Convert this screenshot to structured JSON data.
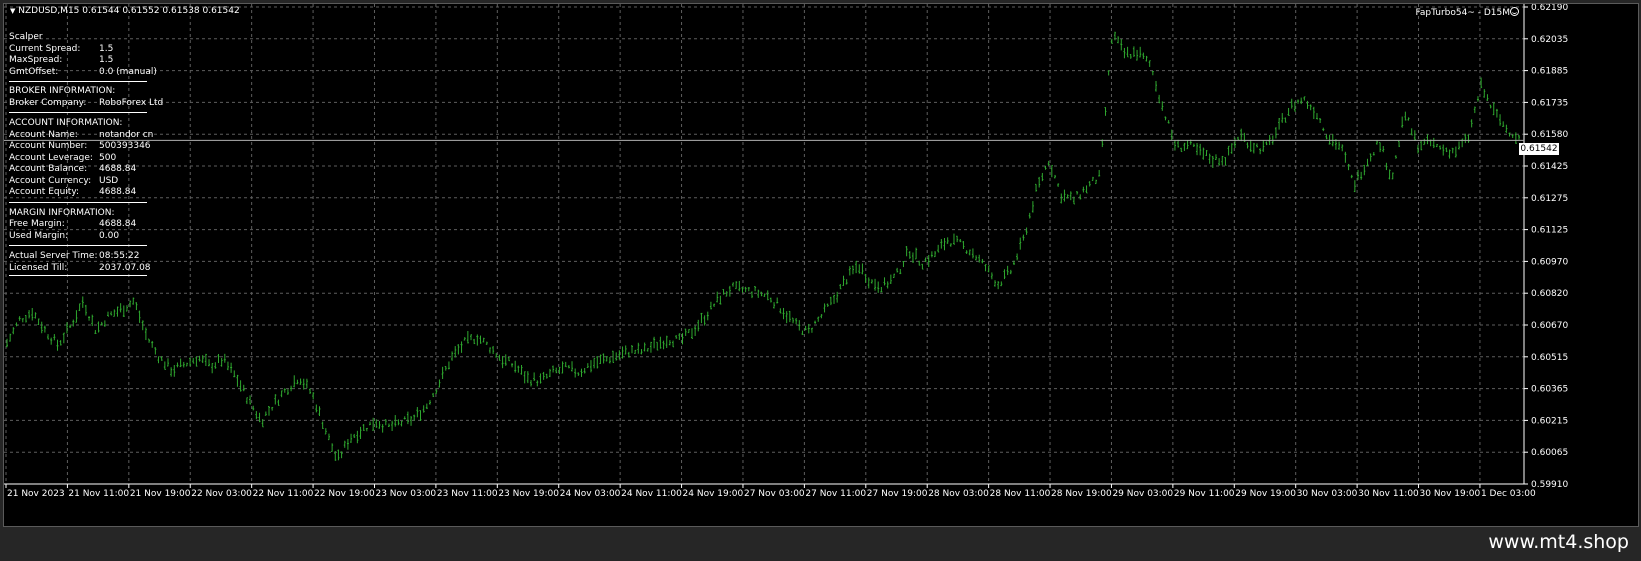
{
  "chart_header": {
    "triangle": "▼",
    "symbol_line": "NZDUSD,M15  0.61544 0.61552 0.61538 0.61542"
  },
  "ea_badge": "FapTurbo54~ - D15M",
  "info_panel": {
    "title": "Scalper",
    "spread_rows": [
      {
        "label": "Current Spread:",
        "value": "1.5"
      },
      {
        "label": "MaxSpread:",
        "value": "1.5"
      },
      {
        "label": "GmtOffset:",
        "value": "0.0 (manual)"
      }
    ],
    "broker_header": "BROKER INFORMATION:",
    "broker_rows": [
      {
        "label": "Broker Company:",
        "value": "RoboForex Ltd"
      }
    ],
    "account_header": "ACCOUNT INFORMATION:",
    "account_rows": [
      {
        "label": "Account Name:",
        "value": "notandor cn"
      },
      {
        "label": "Account Number:",
        "value": "500393346"
      },
      {
        "label": "Account Leverage:",
        "value": "500"
      },
      {
        "label": "Account Balance:",
        "value": "4688.84"
      },
      {
        "label": "Account Currency:",
        "value": "USD"
      },
      {
        "label": "Account Equity:",
        "value": "4688.84"
      }
    ],
    "margin_header": "MARGIN INFORMATION:",
    "margin_rows": [
      {
        "label": "Free Margin:",
        "value": "4688.84"
      },
      {
        "label": "Used Margin:",
        "value": "0.00"
      }
    ],
    "server_rows": [
      {
        "label": "Actual Server Time:",
        "value": "08:55:22"
      },
      {
        "label": "Licensed Till:",
        "value": "2037.07.08"
      }
    ]
  },
  "current_price": "0.61542",
  "footer": {
    "site": "www.mt4.shop"
  },
  "colors": {
    "background": "#000000",
    "grid": "#5e5e5e",
    "bars": "#2fa82f",
    "text": "#ffffff",
    "frame": "#262626"
  },
  "chart_data": {
    "type": "bar",
    "symbol": "NZDUSD",
    "timeframe": "M15",
    "ohlc_last": {
      "open": 0.61544,
      "high": 0.61552,
      "low": 0.61538,
      "close": 0.61542
    },
    "y_ticks": [
      "0.62190",
      "0.62035",
      "0.61885",
      "0.61735",
      "0.61580",
      "0.61425",
      "0.61275",
      "0.61125",
      "0.60970",
      "0.60820",
      "0.60670",
      "0.60515",
      "0.60365",
      "0.60215",
      "0.60065",
      "0.59910"
    ],
    "ylim": [
      0.5991,
      0.6219
    ],
    "x_ticks": [
      "21 Nov 2023",
      "21 Nov 11:00",
      "21 Nov 19:00",
      "22 Nov 03:00",
      "22 Nov 11:00",
      "22 Nov 19:00",
      "23 Nov 03:00",
      "23 Nov 11:00",
      "23 Nov 19:00",
      "24 Nov 03:00",
      "24 Nov 11:00",
      "24 Nov 19:00",
      "27 Nov 03:00",
      "27 Nov 11:00",
      "27 Nov 19:00",
      "28 Nov 03:00",
      "28 Nov 11:00",
      "28 Nov 19:00",
      "29 Nov 03:00",
      "29 Nov 11:00",
      "29 Nov 19:00",
      "30 Nov 03:00",
      "30 Nov 11:00",
      "30 Nov 19:00",
      "1 Dec 03:00"
    ],
    "price_path": [
      0.6058,
      0.6069,
      0.6073,
      0.6064,
      0.6057,
      0.6066,
      0.6078,
      0.6064,
      0.6071,
      0.6074,
      0.6078,
      0.6061,
      0.6051,
      0.6045,
      0.6048,
      0.6051,
      0.6047,
      0.605,
      0.6042,
      0.6031,
      0.6021,
      0.6029,
      0.6036,
      0.6042,
      0.6034,
      0.6018,
      0.6002,
      0.6013,
      0.6017,
      0.6021,
      0.6018,
      0.602,
      0.6022,
      0.6028,
      0.6039,
      0.6051,
      0.6058,
      0.6061,
      0.6056,
      0.605,
      0.6047,
      0.6041,
      0.604,
      0.6044,
      0.6046,
      0.6044,
      0.6048,
      0.605,
      0.6052,
      0.6054,
      0.6054,
      0.6057,
      0.606,
      0.6059,
      0.6064,
      0.6071,
      0.6079,
      0.6084,
      0.6083,
      0.6082,
      0.608,
      0.6074,
      0.6067,
      0.6063,
      0.607,
      0.6078,
      0.6088,
      0.6095,
      0.6087,
      0.6085,
      0.609,
      0.6102,
      0.6096,
      0.61,
      0.6107,
      0.6105,
      0.6101,
      0.6094,
      0.6086,
      0.6092,
      0.6107,
      0.613,
      0.6145,
      0.6128,
      0.6126,
      0.6132,
      0.6137,
      0.6205,
      0.6195,
      0.6196,
      0.619,
      0.6169,
      0.6151,
      0.6152,
      0.6148,
      0.6145,
      0.6146,
      0.6157,
      0.6152,
      0.615,
      0.6159,
      0.617,
      0.6174,
      0.6168,
      0.6156,
      0.6151,
      0.6133,
      0.6144,
      0.6154,
      0.6136,
      0.6167,
      0.6152,
      0.6153,
      0.615,
      0.6149,
      0.6155,
      0.618,
      0.6168,
      0.616,
      0.6155
    ],
    "noise": 0.0005,
    "bars_count": 480,
    "bar_x_range": [
      0.0,
      1.0
    ],
    "grid": true
  }
}
